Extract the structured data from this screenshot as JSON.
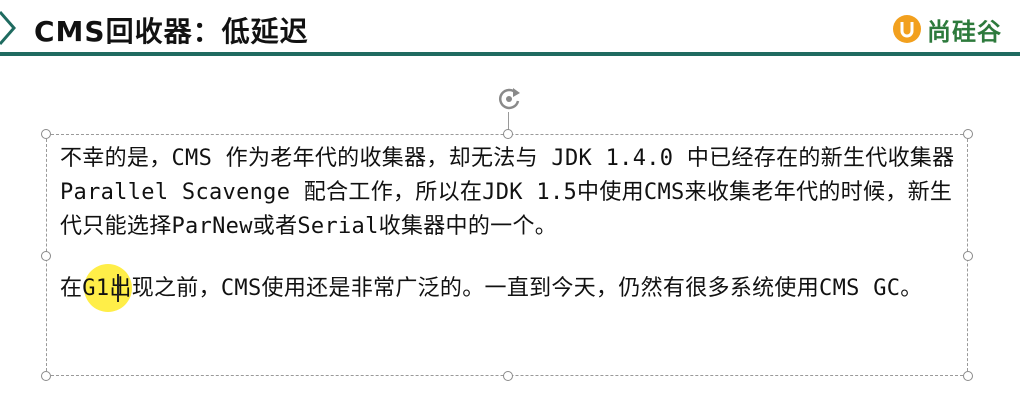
{
  "slide": {
    "title": "CMS回收器：低延迟"
  },
  "logo": {
    "icon": "u-logo-icon",
    "text": "尚硅谷",
    "accent": "#f2a01e",
    "text_color": "#2d7a3c"
  },
  "colors": {
    "rule": "#1f6b60",
    "highlight": "#ffeb28"
  },
  "textbox": {
    "paragraph1": "不幸的是，CMS 作为老年代的收集器，却无法与 JDK 1.4.0 中已经存在的新生代收集器Parallel Scavenge 配合工作，所以在JDK 1.5中使用CMS来收集老年代的时候，新生代只能选择ParNew或者Serial收集器中的一个。",
    "paragraph2": "在G1出现之前，CMS使用还是非常广泛的。一直到今天，仍然有很多系统使用CMS GC。"
  }
}
